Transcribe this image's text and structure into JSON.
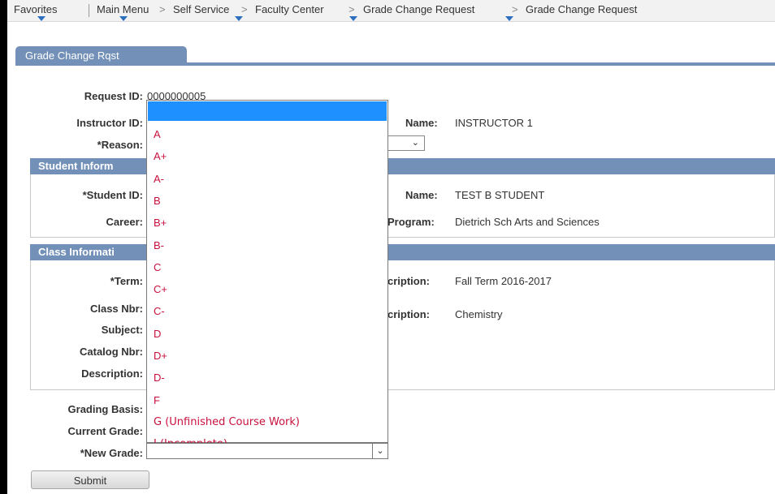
{
  "nav": {
    "favorites": "Favorites",
    "main_menu": "Main Menu",
    "self_service": "Self Service",
    "faculty_center": "Faculty Center",
    "grade_change_request": "Grade Change Request",
    "grade_change_request_2": "Grade Change Request",
    "separator": ">"
  },
  "tab": {
    "label": "Grade Change Rqst"
  },
  "form": {
    "request_id_label": "Request ID:",
    "request_id_value": "0000000005",
    "instructor_id_label": "Instructor ID:",
    "name_label": "Name:",
    "instructor_name": "INSTRUCTOR 1",
    "reason_label": "*Reason:"
  },
  "student_section": {
    "header": "Student Inform",
    "student_id_label": "*Student ID:",
    "name_label": "Name:",
    "student_name": "TEST B STUDENT",
    "career_label": "Career:",
    "program_label": "Program:",
    "program_value": "Dietrich Sch Arts and Sciences"
  },
  "class_section": {
    "header": "Class Informati",
    "term_label": "*Term:",
    "term_desc_label": "cription:",
    "term_desc_value": "Fall Term 2016-2017",
    "class_nbr_label": "Class Nbr:",
    "class_desc_label": "cription:",
    "class_desc_value": "Chemistry",
    "subject_label": "Subject:",
    "catalog_label": "Catalog Nbr:",
    "description_label": "Description:"
  },
  "grading": {
    "grading_basis_label": "Grading Basis:",
    "current_grade_label": "Current Grade:",
    "new_grade_label": "*New Grade:",
    "new_grade_value": ""
  },
  "dropdown_options": [
    "A",
    "A+",
    "A-",
    "B",
    "B+",
    "B-",
    "C",
    "C+",
    "C-",
    "D",
    "D+",
    "D-",
    "F",
    "G (Unfinished Course Work)",
    "I (Incomplete)"
  ],
  "submit_label": "Submit",
  "colors": {
    "header_blue": "#7391b8",
    "option_red": "#c8103e",
    "highlight": "#1e90ff"
  }
}
